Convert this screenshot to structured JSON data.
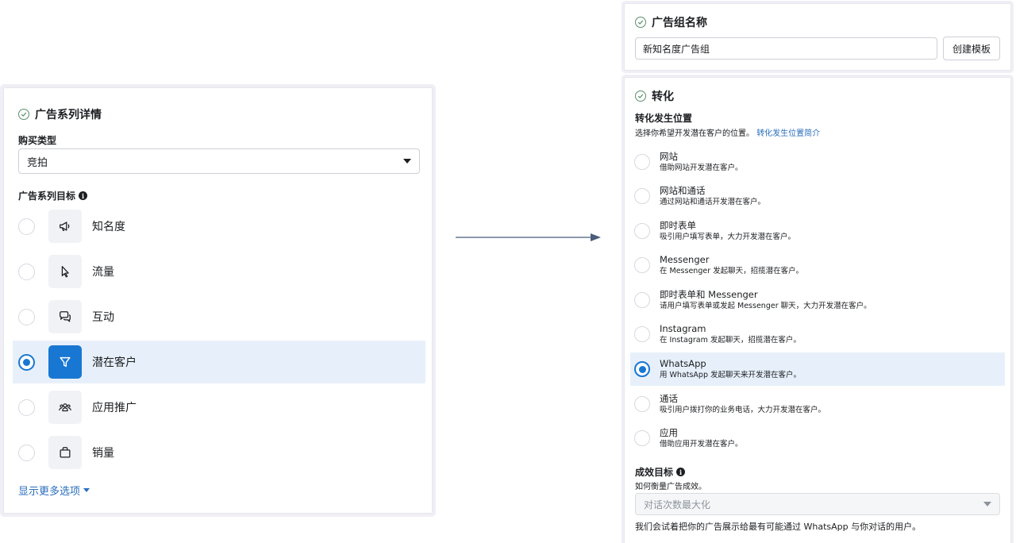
{
  "colors": {
    "accent": "#1877d2",
    "link": "#2a6ebd",
    "selected_bg": "#e7f0fa",
    "check_green": "#5a8f6b"
  },
  "campaign_details": {
    "title": "广告系列详情",
    "buy_type_label": "购买类型",
    "buy_type_value": "竞拍",
    "objective_label": "广告系列目标",
    "objectives": [
      {
        "label": "知名度",
        "icon": "megaphone-icon",
        "selected": false
      },
      {
        "label": "流量",
        "icon": "cursor-icon",
        "selected": false
      },
      {
        "label": "互动",
        "icon": "chat-bubbles-icon",
        "selected": false
      },
      {
        "label": "潜在客户",
        "icon": "funnel-icon",
        "selected": true
      },
      {
        "label": "应用推广",
        "icon": "people-icon",
        "selected": false
      },
      {
        "label": "销量",
        "icon": "shopping-bag-icon",
        "selected": false
      }
    ],
    "show_more": "显示更多选项"
  },
  "ad_set_name": {
    "title": "广告组名称",
    "input_value": "新知名度广告组",
    "template_button": "创建模板"
  },
  "conversion": {
    "title": "转化",
    "location_label": "转化发生位置",
    "location_desc": "选择你希望开发潜在客户的位置。",
    "location_link": "转化发生位置简介",
    "options": [
      {
        "title": "网站",
        "desc": "借助网站开发潜在客户。",
        "selected": false
      },
      {
        "title": "网站和通话",
        "desc": "通过网站和通话开发潜在客户。",
        "selected": false
      },
      {
        "title": "即时表单",
        "desc": "吸引用户填写表单，大力开发潜在客户。",
        "selected": false
      },
      {
        "title": "Messenger",
        "desc": "在 Messenger 发起聊天，招揽潜在客户。",
        "selected": false
      },
      {
        "title": "即时表单和 Messenger",
        "desc": "请用户填写表单或发起 Messenger 聊天，大力开发潜在客户。",
        "selected": false
      },
      {
        "title": "Instagram",
        "desc": "在 Instagram 发起聊天，招揽潜在客户。",
        "selected": false
      },
      {
        "title": "WhatsApp",
        "desc": "用 WhatsApp 发起聊天来开发潜在客户。",
        "selected": true
      },
      {
        "title": "通话",
        "desc": "吸引用户拨打你的业务电话，大力开发潜在客户。",
        "selected": false
      },
      {
        "title": "应用",
        "desc": "借助应用开发潜在客户。",
        "selected": false
      }
    ],
    "goal_label": "成效目标",
    "goal_desc": "如何衡量广告成效。",
    "goal_value": "对话次数最大化",
    "goal_note": "我们会试着把你的广告展示给最有可能通过 WhatsApp 与你对话的用户。"
  }
}
